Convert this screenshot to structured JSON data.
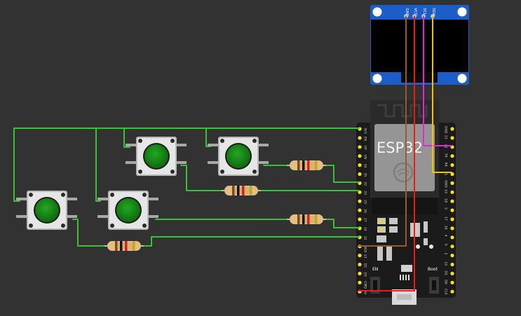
{
  "esp32": {
    "chip_label": "ESP32",
    "en_label": "EN",
    "boot_label": "Boot",
    "left_pins": [
      "3V3",
      "EN",
      "VP",
      "VN",
      "34",
      "35",
      "32",
      "33",
      "25",
      "26",
      "27",
      "14",
      "12",
      "GND",
      "13",
      "D2",
      "D3",
      "CMD",
      "5V"
    ],
    "right_pins": [
      "GND",
      "23",
      "22",
      "TX",
      "RX",
      "21",
      "GND",
      "19",
      "18",
      "5",
      "17",
      "16",
      "4",
      "0",
      "2",
      "15",
      "D1",
      "D0",
      "CLK"
    ]
  },
  "oled": {
    "pins": [
      "GND",
      "VCC",
      "SCL",
      "SDA"
    ]
  },
  "colors": {
    "wire_green": "#36c336",
    "wire_brown": "#9b5a2c",
    "wire_red": "#e81c1c",
    "wire_magenta": "#e02ad6",
    "wire_yellow": "#f2c200",
    "board": "#1b1b1b",
    "pin_yellow": "#f3e21a",
    "oled_blue": "#1c5ec9",
    "button_green": "#178a17"
  }
}
